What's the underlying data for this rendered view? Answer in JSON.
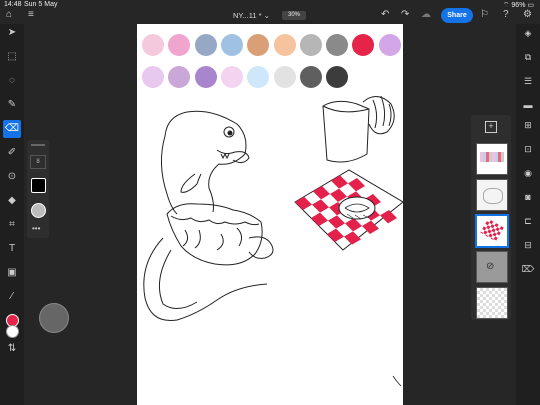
{
  "status": {
    "time": "14:48",
    "date": "Sun 5 May",
    "battery": "96%"
  },
  "document": {
    "title": "NY...11 *",
    "zoom": "30%"
  },
  "toolbar": {
    "share_label": "Share"
  },
  "brush_panel": {
    "size_value": "8"
  },
  "palette": {
    "row1": [
      "#f4c9dd",
      "#f0a5cf",
      "#97a8c4",
      "#9fc2e2",
      "#d9a078",
      "#f6c39f",
      "#b6b6b6",
      "#8a8a8a",
      "#e6244a",
      "#d2a6e8"
    ],
    "row2": [
      "#e9c8ef",
      "#c9a8d8",
      "#a885cc",
      "#f2d3f0",
      "#cfe7fb",
      "#e2e2e2",
      "#5f5f5f",
      "#3c3c3c"
    ]
  },
  "colors": {
    "accent": "#1473e6",
    "foreground_color": "#e6244a",
    "checker_red": "#e3214a"
  }
}
